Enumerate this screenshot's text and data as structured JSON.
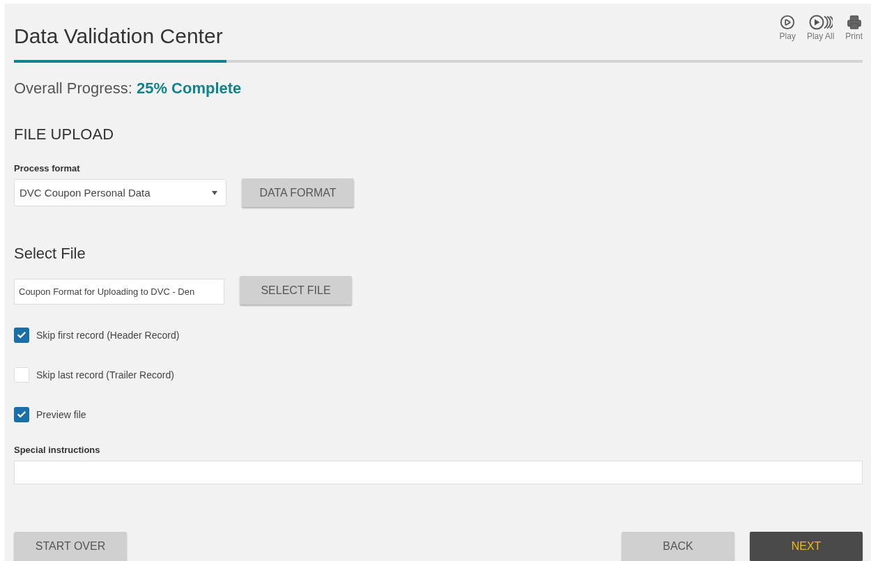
{
  "title": "Data Validation Center",
  "toolbar": [
    {
      "kind": "play",
      "label": "Play"
    },
    {
      "kind": "play_all",
      "label": "Play All"
    },
    {
      "kind": "print",
      "label": "Print"
    }
  ],
  "progress": {
    "level": 0.25,
    "label": "Overall Progress:",
    "value": "25% Complete"
  },
  "section_title": "FILE UPLOAD",
  "process_format": {
    "label": "Process format",
    "value": "DVC Coupon Personal Data",
    "button": "DATA FORMAT"
  },
  "select_file": {
    "heading": "Select File",
    "value": "Coupon Format for Uploading to DVC - Den",
    "button": "SELECT FILE"
  },
  "options": [
    {
      "label": "Skip first record (Header Record)",
      "checked": true
    },
    {
      "label": "Skip last record (Trailer Record)",
      "checked": false
    },
    {
      "label": "Preview file",
      "checked": true
    }
  ],
  "special_instructions": {
    "label": "Special instructions"
  },
  "footer": {
    "start_over": "START OVER",
    "back": "BACK",
    "next": "NEXT"
  }
}
